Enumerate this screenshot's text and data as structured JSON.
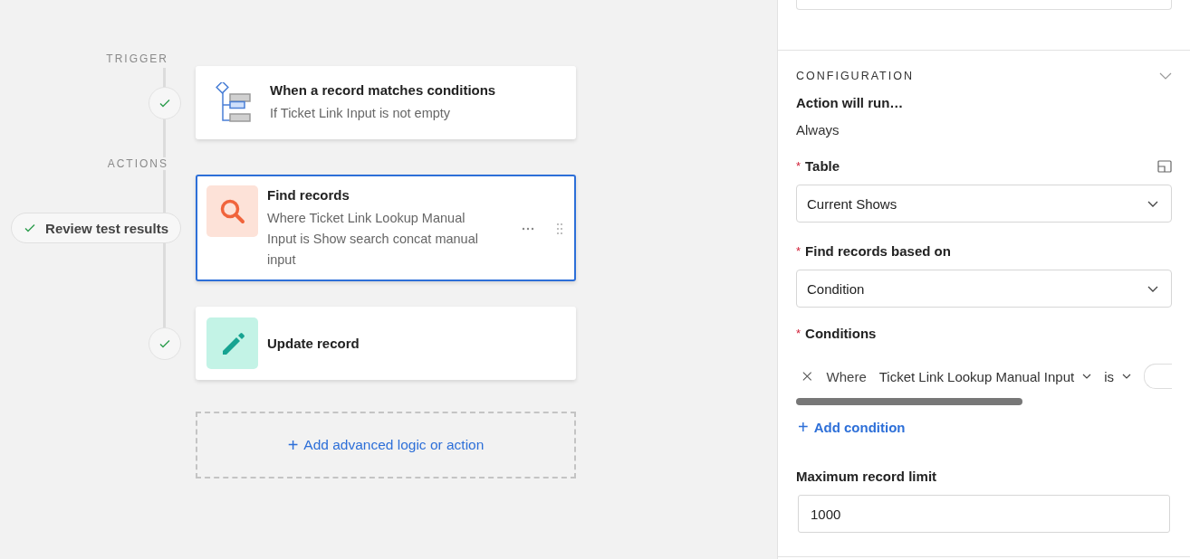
{
  "canvas": {
    "trigger_label": "TRIGGER",
    "actions_label": "ACTIONS",
    "trigger": {
      "kind": "trigger",
      "title": "When a record matches conditions",
      "subtitle": "If Ticket Link Input is not empty",
      "selected": false
    },
    "actions": [
      {
        "kind": "find",
        "title": "Find records",
        "subtitle": "Where Ticket Link Lookup Manual Input is Show search concat manual input",
        "selected": true,
        "badge": "Review test results"
      },
      {
        "kind": "update",
        "title": "Update record",
        "selected": false
      }
    ],
    "add_button": {
      "icon": "+",
      "label": "Add advanced logic or action"
    }
  },
  "panel": {
    "section_title": "CONFIGURATION",
    "expanded": true,
    "run_label": "Action will run…",
    "run_value": "Always",
    "fields": [
      {
        "kind": "select",
        "label": "Table",
        "required_mark": "*",
        "value": "Current Shows",
        "expand_icon": true
      },
      {
        "kind": "select",
        "label": "Find records based on",
        "required_mark": "*",
        "value": "Condition"
      },
      {
        "kind": "conditions",
        "label": "Conditions",
        "required_mark": "*",
        "condition": {
          "prefix": "Where",
          "field": "Ticket Link Lookup Manual Input",
          "operator": "is"
        },
        "add_icon": "+",
        "add_label": "Add condition"
      },
      {
        "kind": "input",
        "label": "Maximum record limit",
        "value": "1000"
      }
    ]
  }
}
